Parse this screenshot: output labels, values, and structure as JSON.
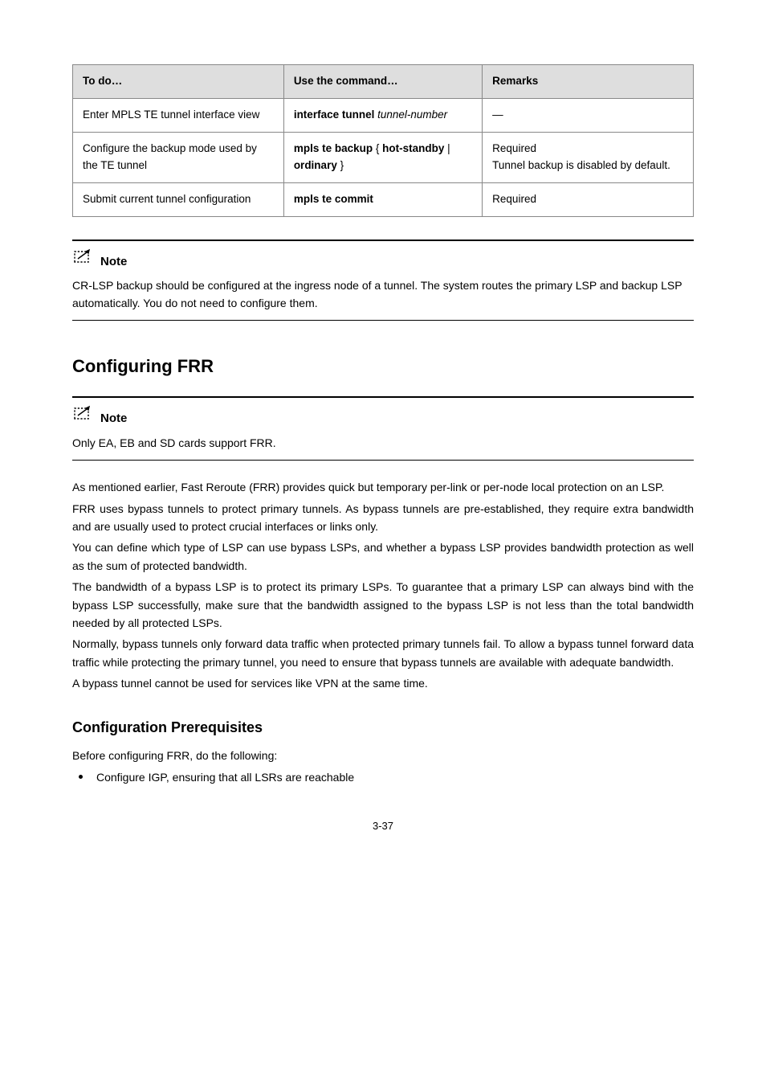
{
  "table": {
    "headers": [
      "To do…",
      "Use the command…",
      "Remarks"
    ],
    "rows": [
      {
        "todo": "Enter MPLS TE tunnel interface view",
        "cmd_pre": "interface tunnel",
        "cmd_arg": " tunnel-number",
        "remarks": "—"
      },
      {
        "todo": "Configure the backup mode used by the TE tunnel",
        "cmd_pre": "mpls te backup",
        "cmd_open": " { ",
        "cmd_opt1": "hot-standby",
        "cmd_sep": " | ",
        "cmd_opt2": "ordinary",
        "cmd_close": " }",
        "remarks_l1": "Required",
        "remarks_l2": "Tunnel backup is disabled by default."
      },
      {
        "todo": "Submit current tunnel configuration",
        "cmd_pre": "mpls te commit",
        "remarks": "Required"
      }
    ]
  },
  "note1": {
    "label": " Note",
    "body": "CR-LSP backup should be configured at the ingress node of a tunnel. The system routes the primary LSP and backup LSP automatically. You do not need to configure them."
  },
  "section_title": "Configuring FRR",
  "note2": {
    "label": " Note",
    "body": "Only EA, EB and SD cards support FRR."
  },
  "paragraphs": {
    "p1": "As mentioned earlier, Fast Reroute (FRR) provides quick but temporary per-link or per-node local protection on an LSP.",
    "p2": "FRR uses bypass tunnels to protect primary tunnels. As bypass tunnels are pre-established, they require extra bandwidth and are usually used to protect crucial interfaces or links only.",
    "p3": "You can define which type of LSP can use bypass LSPs, and whether a bypass LSP provides bandwidth protection as well as the sum of protected bandwidth.",
    "p4": "The bandwidth of a bypass LSP is to protect its primary LSPs. To guarantee that a primary LSP can always bind with the bypass LSP successfully, make sure that the bandwidth assigned to the bypass LSP is not less than the total bandwidth needed by all protected LSPs.",
    "p5": "Normally, bypass tunnels only forward data traffic when protected primary tunnels fail. To allow a bypass tunnel forward data traffic while protecting the primary tunnel, you need to ensure that bypass tunnels are available with adequate bandwidth.",
    "p6": "A bypass tunnel cannot be used for services like VPN at the same time."
  },
  "subhead": "Configuration Prerequisites",
  "prereq_intro": "Before configuring FRR, do the following:",
  "bullets": {
    "b1": "Configure IGP, ensuring that all LSRs are reachable"
  },
  "page_num": "3-37"
}
